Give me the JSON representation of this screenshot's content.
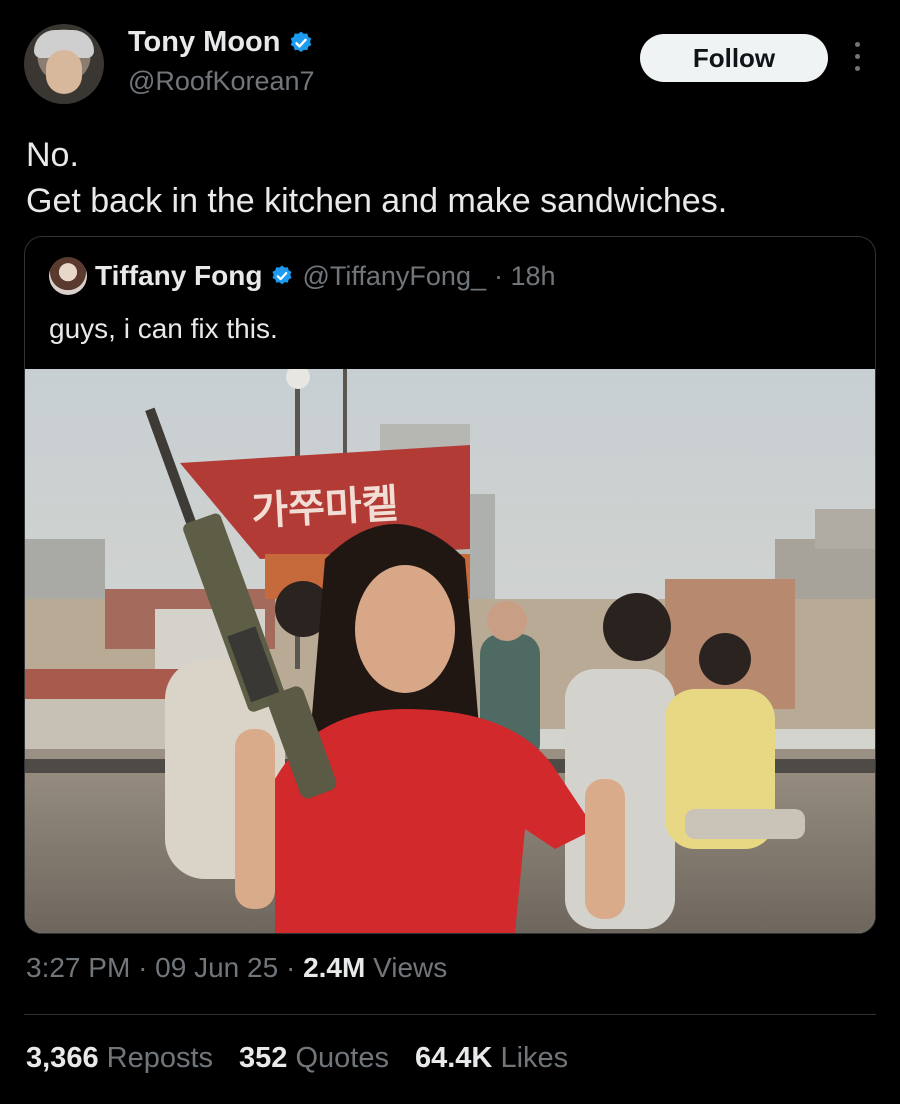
{
  "author": {
    "name": "Tony Moon",
    "handle": "@RoofKorean7",
    "verified": true
  },
  "follow_label": "Follow",
  "tweet": {
    "line1": "No.",
    "line2": "Get back in the kitchen and make sandwiches."
  },
  "quoted": {
    "name": "Tiffany Fong",
    "handle": "@TiffanyFong_",
    "age": "· 18h",
    "text": "guys, i can fix this.",
    "sign_text": "가쭈마켙"
  },
  "meta": {
    "time": "3:27 PM",
    "date": "09 Jun 25",
    "views_count": "2.4M",
    "views_label": "Views",
    "sep": "·"
  },
  "stats": {
    "reposts_count": "3,366",
    "reposts_label": "Reposts",
    "quotes_count": "352",
    "quotes_label": "Quotes",
    "likes_count": "64.4K",
    "likes_label": "Likes"
  },
  "colors": {
    "background": "#000000",
    "text": "#e7e9ea",
    "secondary": "#71767b",
    "verified": "#1d9bf0",
    "border": "#2f3336"
  }
}
